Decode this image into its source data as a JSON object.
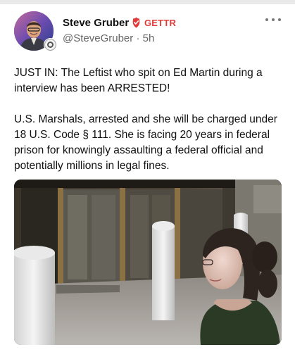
{
  "post": {
    "author_name": "Steve Gruber",
    "platform_label": "GETTR",
    "handle": "@SteveGruber",
    "separator": "·",
    "time_ago": "5h",
    "text_paragraph_1": "JUST IN: The Leftist who spit on Ed Martin during a interview has been ARRESTED!",
    "text_paragraph_2": "U.S. Marshals, arrested and she will be charged under 18 U.S. Code § 111. She is facing 20 years in federal prison for knowingly assaulting a federal official and potentially millions in legal fines."
  },
  "icons": {
    "avatar": "author-avatar",
    "verified": "verified-badge-icon",
    "more": "more-options-icon"
  },
  "colors": {
    "platform_red": "#e03a3a",
    "handle_gray": "#666666",
    "text": "#111111"
  }
}
